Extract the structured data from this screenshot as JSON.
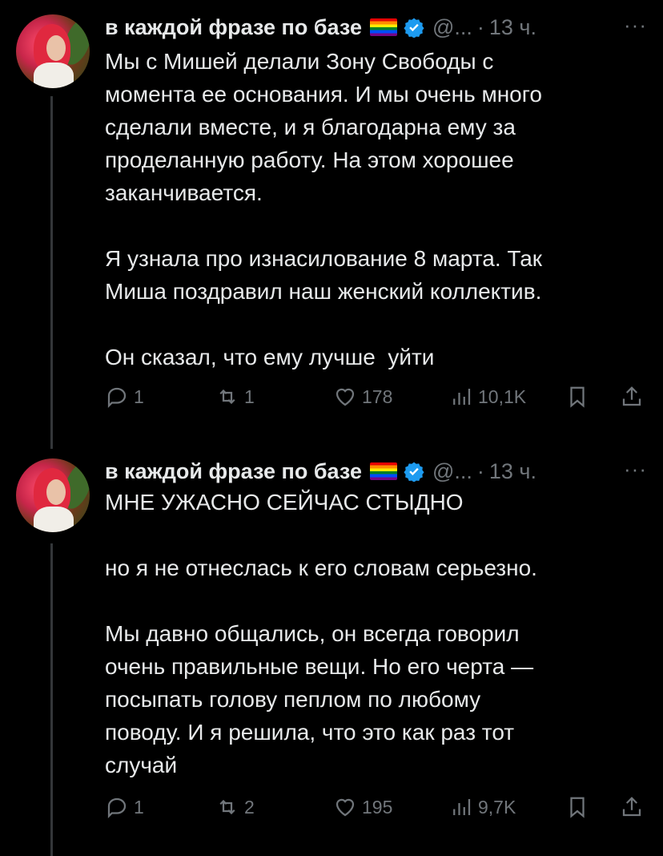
{
  "tweets": [
    {
      "author_name": "в каждой фразе по базе",
      "handle": "@...",
      "time": "13 ч.",
      "text": "Мы с Мишей делали Зону Свободы с\nмомента ее основания. И мы очень много\nсделали вместе, и я благодарна ему за\nпроделанную работу. На этом хорошее\nзаканчивается.\n\nЯ узнала про изнасилование 8 марта. Так\nМиша поздравил наш женский коллектив.\n\nОн сказал, что ему лучше  уйти",
      "replies": "1",
      "reposts": "1",
      "likes": "178",
      "views": "10,1K"
    },
    {
      "author_name": "в каждой фразе по базе",
      "handle": "@...",
      "time": "13 ч.",
      "text": "МНЕ УЖАСНО СЕЙЧАС СТЫДНО\n\nно я не отнеслась к его словам серьезно.\n\nМы давно общались, он всегда говорил\nочень правильные вещи. Но его черта —\nпосыпать голову пеплом по любому\nповоду. И я решила, что это как раз тот\nслучай",
      "replies": "1",
      "reposts": "2",
      "likes": "195",
      "views": "9,7K"
    }
  ],
  "separator_dot": "·",
  "more_label": "···",
  "colors": {
    "background": "#000000",
    "text": "#e7e9ea",
    "muted": "#71767b",
    "verified": "#1d9bf0",
    "thread_line": "#333639"
  }
}
